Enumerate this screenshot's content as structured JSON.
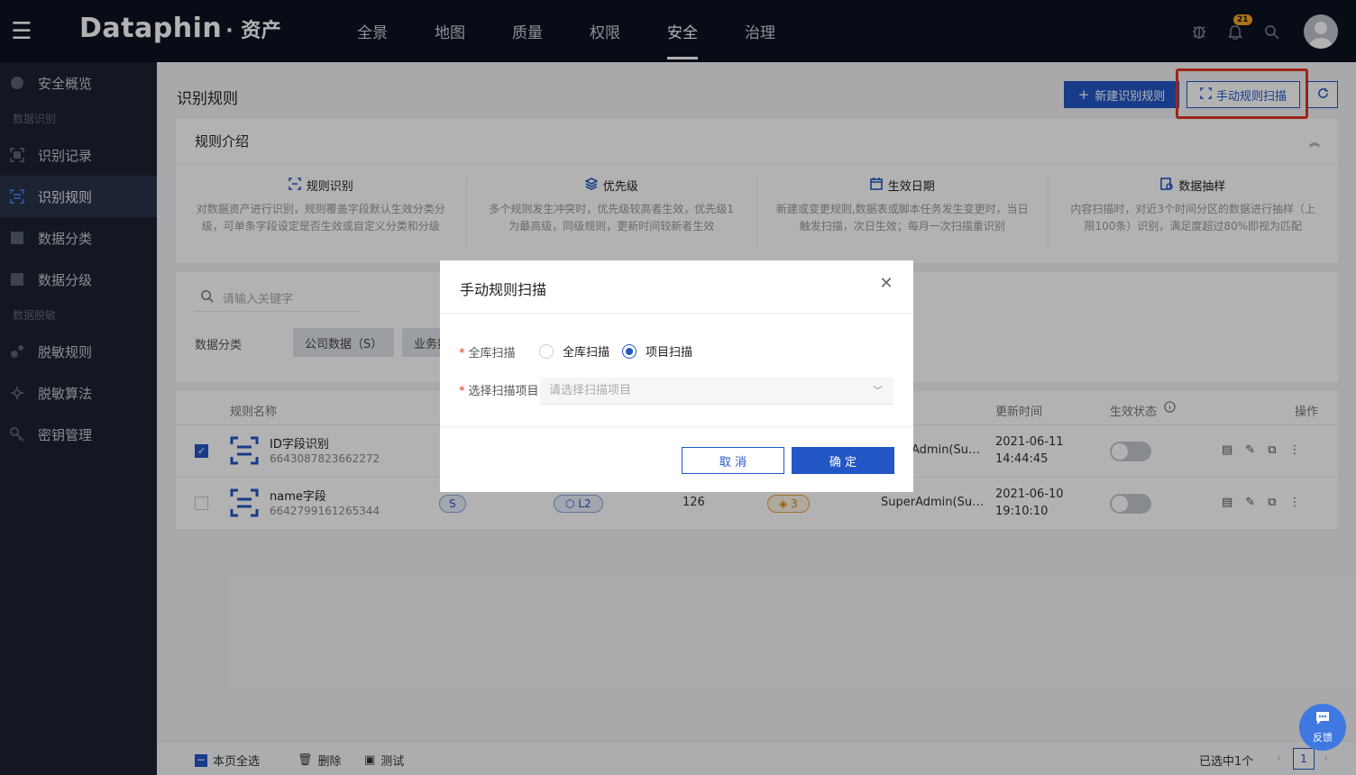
{
  "header": {
    "brand": "Dataphin",
    "brand_sub": "· 资产",
    "nav": [
      "全景",
      "地图",
      "质量",
      "权限",
      "安全",
      "治理"
    ],
    "active_nav": "安全",
    "notification_count": "21"
  },
  "sidebar": {
    "items": [
      {
        "label": "安全概览"
      },
      {
        "group": "数据识别"
      },
      {
        "label": "识别记录"
      },
      {
        "label": "识别规则"
      },
      {
        "label": "数据分类"
      },
      {
        "label": "数据分级"
      },
      {
        "group": "数据脱敏"
      },
      {
        "label": "脱敏规则"
      },
      {
        "label": "脱敏算法"
      },
      {
        "label": "密钥管理"
      }
    ]
  },
  "page": {
    "title": "识别规则",
    "new_button": "新建识别规则",
    "scan_button": "手动规则扫描"
  },
  "intro": {
    "title": "规则介绍",
    "columns": [
      {
        "title": "规则识别",
        "desc": "对数据资产进行识别，规则覆盖字段默认生效分类分级，可单条字段设定是否生效或自定义分类和分级"
      },
      {
        "title": "优先级",
        "desc": "多个规则发生冲突时，优先级较高者生效，优先级1为最高级，同级规则，更新时间较新者生效"
      },
      {
        "title": "生效日期",
        "desc": "新建或变更规则,数据表或脚本任务发生变更时，当日触发扫描，次日生效；每月一次扫描重识别"
      },
      {
        "title": "数据抽样",
        "desc": "内容扫描时，对近3个时间分区的数据进行抽样（上限100条）识别，满足度超过80%即视为匹配"
      }
    ]
  },
  "filter": {
    "search_placeholder": "请输入关键字",
    "label": "数据分类",
    "chips": [
      "公司数据（S）",
      "业务数"
    ]
  },
  "table": {
    "headers": {
      "name": "规则名称",
      "updated": "更新时间",
      "status": "生效状态",
      "ops": "操作"
    },
    "rows": [
      {
        "name": "ID字段识别",
        "id": "6643087823662272",
        "creator": "Admin(Su…",
        "date": "2021-06-11",
        "time": "14:44:45"
      },
      {
        "name": "name字段",
        "id": "6642799161265344",
        "tag_s": "S",
        "tag_l": "L2",
        "count": "126",
        "tag_w": "3",
        "creator": "SuperAdmin(Su…",
        "date": "2021-06-10",
        "time": "19:10:10"
      }
    ]
  },
  "footer": {
    "select_all": "本页全选",
    "delete": "删除",
    "test": "测试",
    "selected": "已选中1个",
    "page": "1"
  },
  "modal": {
    "title": "手动规则扫描",
    "field1_label": "全库扫描",
    "radio_full": "全库扫描",
    "radio_project": "项目扫描",
    "field2_label": "选择扫描项目",
    "select_placeholder": "请选择扫描项目",
    "cancel": "取 消",
    "ok": "确 定"
  },
  "feedback": "反馈"
}
